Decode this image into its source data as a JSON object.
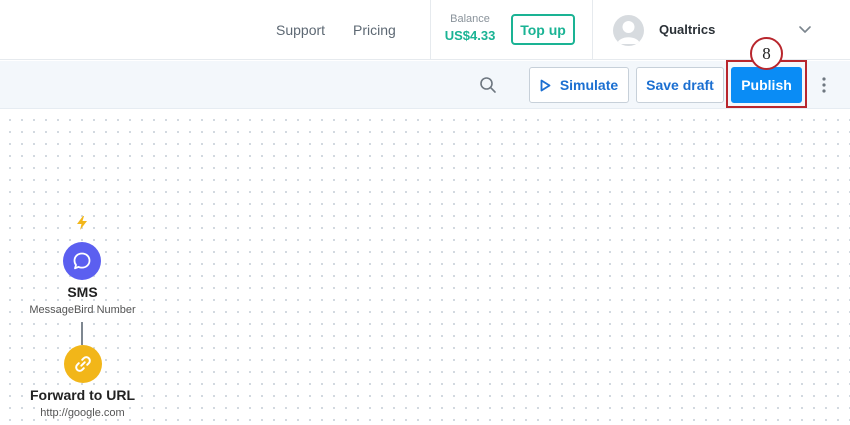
{
  "topbar": {
    "nav": {
      "support": "Support",
      "pricing": "Pricing"
    },
    "balance": {
      "label": "Balance",
      "value": "US$4.33"
    },
    "topup_label": "Top up",
    "account_name": "Qualtrics"
  },
  "toolbar": {
    "simulate_label": "Simulate",
    "save_draft_label": "Save draft",
    "publish_label": "Publish"
  },
  "step_badge": "8",
  "flow": {
    "trigger_icon": "lightning-bolt-icon",
    "nodes": [
      {
        "title": "SMS",
        "subtitle": "MessageBird Number",
        "icon": "chat-bubble-icon"
      },
      {
        "title": "Forward to URL",
        "subtitle": "http://google.com",
        "icon": "link-icon"
      }
    ]
  },
  "colors": {
    "accent_green": "#1ab394",
    "publish_blue": "#0a8cf5",
    "highlight_red": "#b8262d",
    "sms_purple": "#5b5ff0",
    "url_yellow": "#f2b619"
  }
}
